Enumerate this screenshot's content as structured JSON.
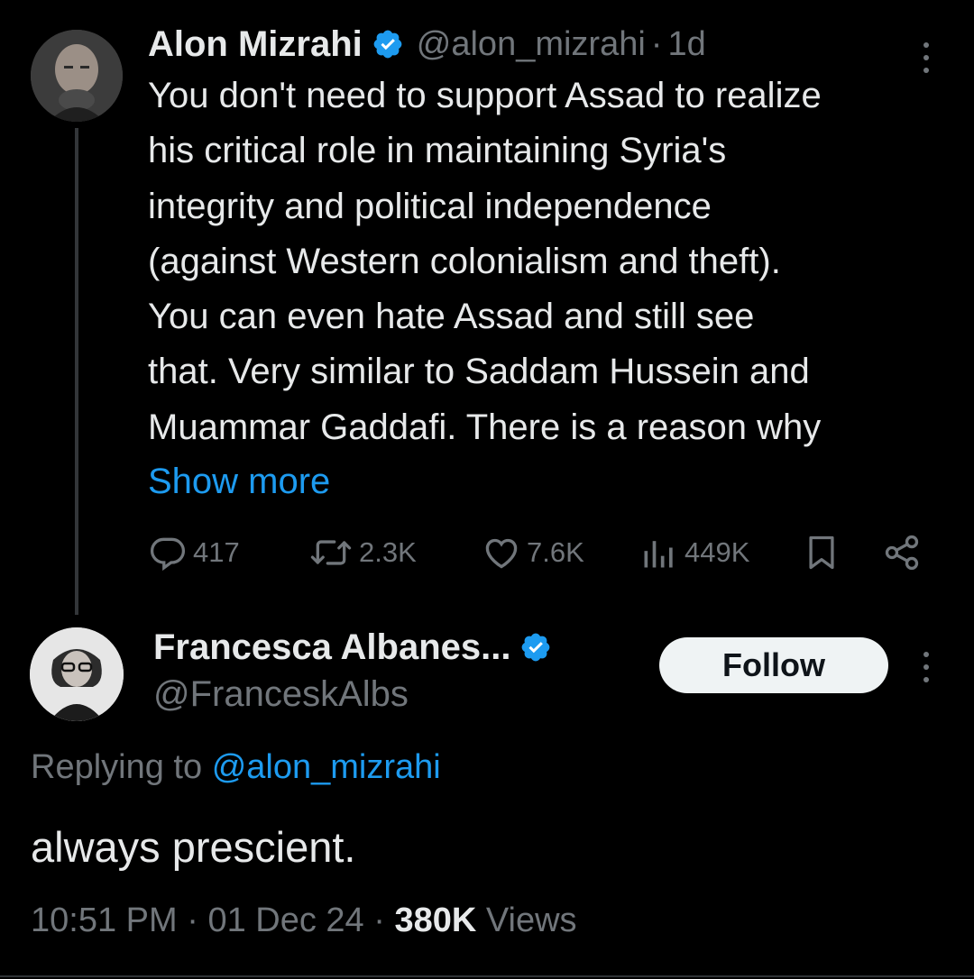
{
  "colors": {
    "background": "#000000",
    "text_primary": "#e7e9ea",
    "text_secondary": "#71767b",
    "accent": "#1d9bf0",
    "verified_badge": "#1d9bf0",
    "follow_button_bg": "#eff3f4"
  },
  "parent_tweet": {
    "author_name": "Alon Mizrahi",
    "handle": "@alon_mizrahi",
    "separator": "·",
    "age": "1d",
    "avatar_icon": "user-avatar",
    "verified_icon": "verified-badge-icon",
    "text_lines": [
      "You don't need to support Assad to realize",
      "his critical role in maintaining Syria's",
      "integrity and political independence",
      "(against Western colonialism and theft).",
      "You can even hate Assad and still see",
      "that. Very similar to Saddam Hussein and",
      "Muammar Gaddafi. There is a reason why"
    ],
    "show_more_label": "Show more",
    "actions": {
      "replies": "417",
      "reposts": "2.3K",
      "likes": "7.6K",
      "views": "449K"
    }
  },
  "reply_tweet": {
    "author_name": "Francesca Albanes...",
    "handle": "@FranceskAlbs",
    "follow_label": "Follow",
    "replying_prefix": "Replying to",
    "replying_mention": "@alon_mizrahi",
    "text": "always prescient.",
    "time": "10:51 PM",
    "separator": "·",
    "date": "01 Dec 24",
    "views_count": "380K",
    "views_label": "Views"
  }
}
